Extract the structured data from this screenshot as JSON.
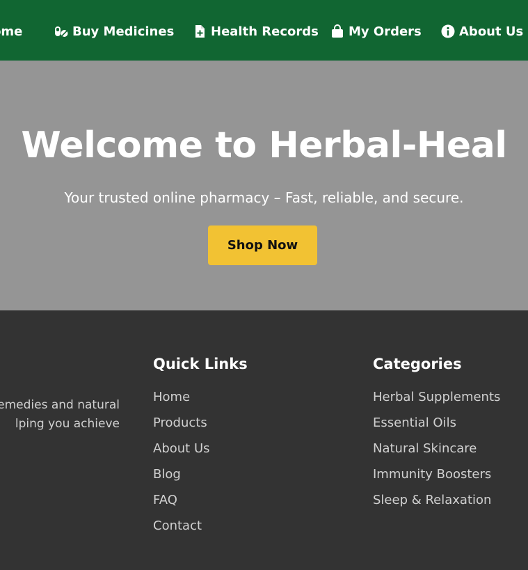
{
  "nav": {
    "items": [
      {
        "label": "Home",
        "icon": "home-icon"
      },
      {
        "label": "Buy Medicines",
        "icon": "pills-icon"
      },
      {
        "label": "Health Records",
        "icon": "file-medical-icon"
      },
      {
        "label": "My Orders",
        "icon": "shopping-bag-icon"
      },
      {
        "label": "About Us",
        "icon": "info-circle-icon"
      }
    ],
    "background": "#116632"
  },
  "hero": {
    "title": "Welcome to Herbal-Heal",
    "subtitle": "Your trusted online pharmacy – Fast, reliable, and secure.",
    "cta_label": "Shop Now",
    "background": "#959595",
    "cta_color": "#f2c233"
  },
  "footer": {
    "about_line1": "emedies and natural",
    "about_line2": "lping you achieve",
    "quick_links": {
      "heading": "Quick Links",
      "items": [
        "Home",
        "Products",
        "About Us",
        "Blog",
        "FAQ",
        "Contact"
      ]
    },
    "categories": {
      "heading": "Categories",
      "items": [
        "Herbal Supplements",
        "Essential Oils",
        "Natural Skincare",
        "Immunity Boosters",
        "Sleep & Relaxation"
      ]
    },
    "background": "#333333"
  }
}
